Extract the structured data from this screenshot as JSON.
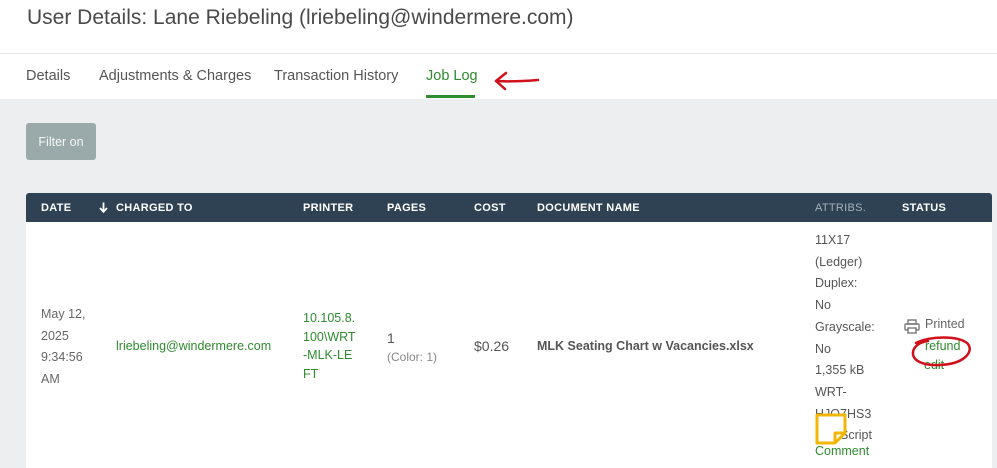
{
  "page": {
    "title": "User Details: Lane Riebeling (lriebeling@windermere.com)"
  },
  "tabs": [
    {
      "label": "Details",
      "active": false
    },
    {
      "label": "Adjustments & Charges",
      "active": false
    },
    {
      "label": "Transaction History",
      "active": false
    },
    {
      "label": "Job Log",
      "active": true
    }
  ],
  "filter_button": {
    "label": "Filter on"
  },
  "table": {
    "columns": [
      "DATE",
      "CHARGED TO",
      "PRINTER",
      "PAGES",
      "COST",
      "DOCUMENT NAME",
      "ATTRIBS.",
      "STATUS"
    ],
    "sort_column": "DATE",
    "rows": [
      {
        "date_line1": "May 12,",
        "date_line2": "2025",
        "date_line3": "9:34:56",
        "date_line4": "AM",
        "charged_to": "lriebeling@windermere.com",
        "printer": "10.105.8.100\\WRT-MLK-LEFT",
        "pages": "1",
        "pages_color": "(Color: 1)",
        "cost": "$0.26",
        "document_name": "MLK Seating Chart w Vacancies.xlsx",
        "attribs": [
          "11X17",
          "(Ledger)",
          "Duplex:",
          "No",
          "Grayscale:",
          "No",
          "1,355 kB",
          "WRT-",
          "HJQ7HS3",
          "PostScript"
        ],
        "comment_label": "Comment",
        "status": "Printed",
        "refund_label": "refund",
        "edit_label": "edit"
      }
    ]
  },
  "icons": {
    "sort": "arrow-down-icon",
    "printer": "printer-icon",
    "comment": "note-icon"
  },
  "colors": {
    "accent_green": "#2e8b2e",
    "table_header": "#2e4253",
    "annotation_red": "#d0101a",
    "comment_icon": "#f2b705"
  }
}
